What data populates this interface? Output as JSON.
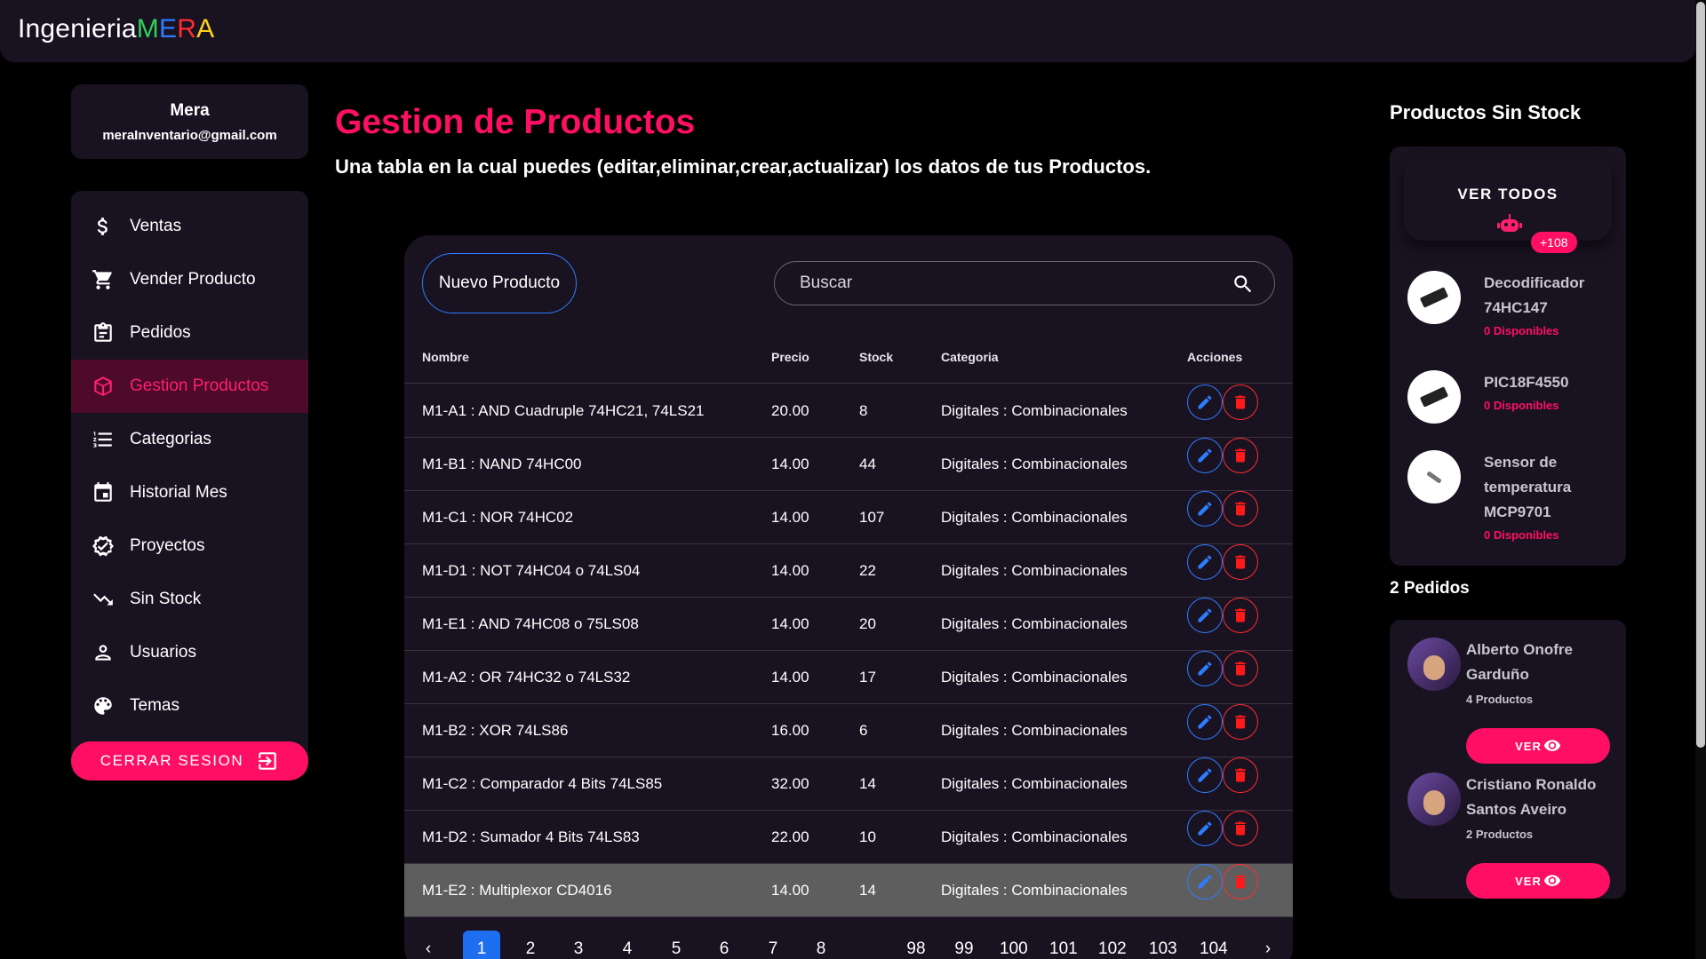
{
  "brand": {
    "part1": "Ingenieria",
    "m": "M",
    "e": "E",
    "r": "R",
    "a": "A"
  },
  "profile": {
    "name": "Mera",
    "email": "meraInventario@gmail.com"
  },
  "nav": [
    {
      "label": "Ventas",
      "icon": "dollar-icon"
    },
    {
      "label": "Vender Producto",
      "icon": "cart-icon"
    },
    {
      "label": "Pedidos",
      "icon": "clipboard-icon"
    },
    {
      "label": "Gestion Productos",
      "icon": "box-icon"
    },
    {
      "label": "Categorias",
      "icon": "list-icon"
    },
    {
      "label": "Historial Mes",
      "icon": "calendar-icon"
    },
    {
      "label": "Proyectos",
      "icon": "verified-icon"
    },
    {
      "label": "Sin Stock",
      "icon": "trending-down-icon"
    },
    {
      "label": "Usuarios",
      "icon": "user-icon"
    },
    {
      "label": "Temas",
      "icon": "palette-icon"
    }
  ],
  "logout_label": "CERRAR SESION",
  "page": {
    "title": "Gestion de Productos",
    "subtitle": "Una tabla en la cual puedes (editar,eliminar,crear,actualizar) los datos de tus Productos."
  },
  "toolbar": {
    "new_label": "Nuevo Producto",
    "search_placeholder": "Buscar"
  },
  "table": {
    "headers": [
      "Nombre",
      "Precio",
      "Stock",
      "Categoria",
      "Acciones"
    ],
    "rows": [
      [
        "M1-A1 : AND Cuadruple 74HC21, 74LS21",
        "20.00",
        "8",
        "Digitales : Combinacionales"
      ],
      [
        "M1-B1 : NAND 74HC00",
        "14.00",
        "44",
        "Digitales : Combinacionales"
      ],
      [
        "M1-C1 : NOR 74HC02",
        "14.00",
        "107",
        "Digitales : Combinacionales"
      ],
      [
        "M1-D1 : NOT 74HC04 o 74LS04",
        "14.00",
        "22",
        "Digitales : Combinacionales"
      ],
      [
        "M1-E1 : AND 74HC08 o 75LS08",
        "14.00",
        "20",
        "Digitales : Combinacionales"
      ],
      [
        "M1-A2 : OR 74HC32 o 74LS32",
        "14.00",
        "17",
        "Digitales : Combinacionales"
      ],
      [
        "M1-B2 : XOR 74LS86",
        "16.00",
        "6",
        "Digitales : Combinacionales"
      ],
      [
        "M1-C2 : Comparador 4 Bits 74LS85",
        "32.00",
        "14",
        "Digitales : Combinacionales"
      ],
      [
        "M1-D2 : Sumador 4 Bits 74LS83",
        "22.00",
        "10",
        "Digitales : Combinacionales"
      ],
      [
        "M1-E2 : Multiplexor CD4016",
        "14.00",
        "14",
        "Digitales : Combinacionales"
      ]
    ],
    "selected_row": 9
  },
  "pagination": {
    "prev": "‹",
    "next": "›",
    "pages": [
      "1",
      "2",
      "3",
      "4",
      "5",
      "6",
      "7",
      "8",
      "98",
      "99",
      "100",
      "101",
      "102",
      "103",
      "104"
    ],
    "current": "1"
  },
  "sin_stock": {
    "title": "Productos Sin Stock",
    "ver_todos": "VER TODOS",
    "badge": "+108",
    "items": [
      {
        "name": "Decodificador 74HC147",
        "avail": "0 Disponibles"
      },
      {
        "name": "PIC18F4550",
        "avail": "0 Disponibles"
      },
      {
        "name": "Sensor de temperatura MCP9701",
        "avail": "0 Disponibles"
      }
    ]
  },
  "pedidos": {
    "title": "2 Pedidos",
    "items": [
      {
        "name": "Alberto Onofre Garduño",
        "count": "4 Productos",
        "ver": "VER"
      },
      {
        "name": "Cristiano Ronaldo Santos Aveiro",
        "count": "2 Productos",
        "ver": "VER"
      }
    ]
  },
  "colors": {
    "accent": "#ff0f63",
    "blue": "#2e7dff",
    "panel": "#191221",
    "bg": "#000000"
  }
}
